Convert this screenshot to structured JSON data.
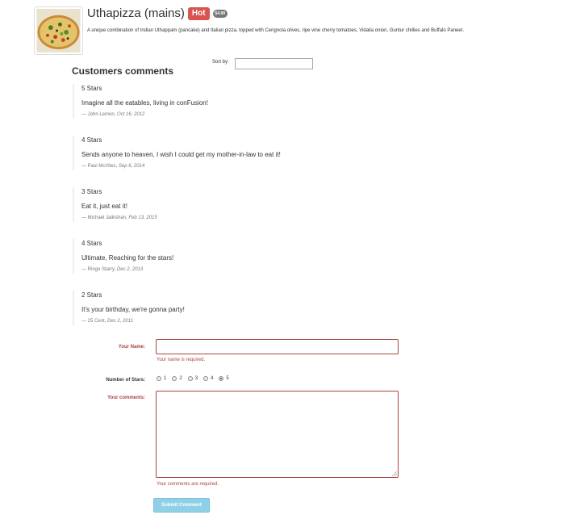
{
  "dish": {
    "name": "Uthapizza (mains)",
    "label": "Hot",
    "price": "$4.99",
    "description": "A unique combination of Indian Uthappam (pancake) and Italian pizza, topped with Cerignola olives, ripe vine cherry tomatoes, Vidalia onion, Guntur chillies and Buffalo Paneer.",
    "image_alt": "pizza-image"
  },
  "sort": {
    "label": "Sort by:",
    "value": ""
  },
  "comments_heading": "Customers comments",
  "comments": [
    {
      "stars": "5 Stars",
      "text": "Imagine all the eatables, living in conFusion!",
      "author": "— John Lemon,",
      "date": "Oct 16, 2012"
    },
    {
      "stars": "4 Stars",
      "text": "Sends anyone to heaven, I wish I could get my mother-in-law to eat it!",
      "author": "— Paul McVites,",
      "date": "Sep 6, 2014"
    },
    {
      "stars": "3 Stars",
      "text": "Eat it, just eat it!",
      "author": "— Michael Jaikishan,",
      "date": "Feb 13, 2015"
    },
    {
      "stars": "4 Stars",
      "text": "Ultimate, Reaching for the stars!",
      "author": "— Ringo Starry,",
      "date": "Dec 2, 2013"
    },
    {
      "stars": "2 Stars",
      "text": "It's your birthday, we're gonna party!",
      "author": "— 25 Cent,",
      "date": "Dec 2, 2011"
    }
  ],
  "form": {
    "name_label": "Your Name:",
    "name_value": "",
    "name_error": "Your name is required.",
    "stars_label": "Number of Stars:",
    "star_options": [
      "1",
      "2",
      "3",
      "4",
      "5"
    ],
    "selected_star": "5",
    "comments_label": "Your comments:",
    "comments_value": "",
    "comments_error": "Your comments are required.",
    "submit_label": "Submit Comment"
  },
  "colors": {
    "hot": "#d9534f",
    "error": "#a94442",
    "submit": "#8fd0e6",
    "price_badge": "#777777"
  }
}
